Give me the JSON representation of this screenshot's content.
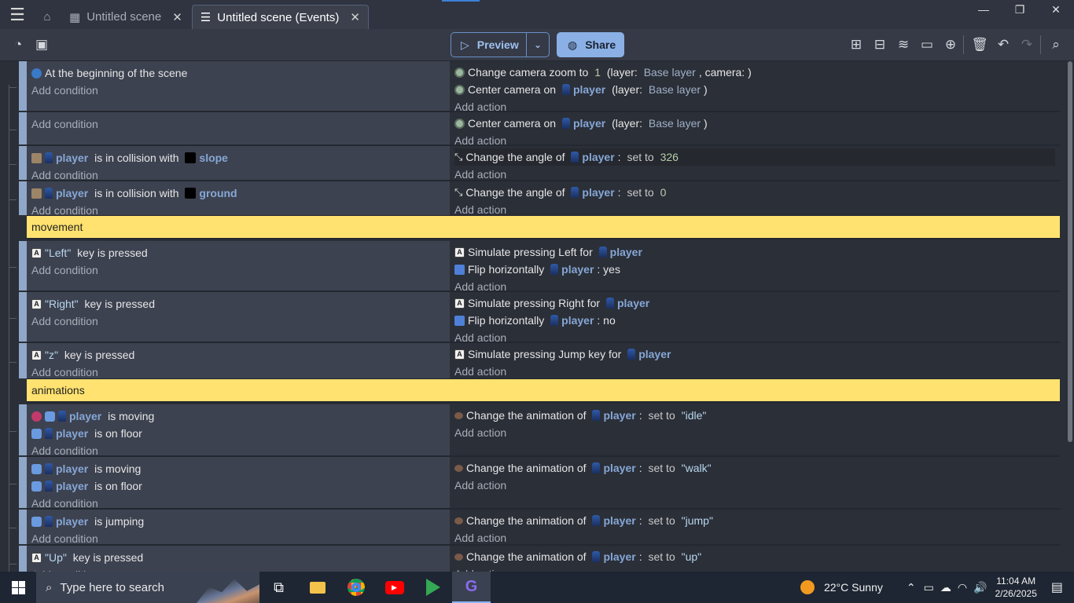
{
  "titlebar": {
    "tabs": [
      {
        "label": "Untitled scene"
      },
      {
        "label": "Untitled scene (Events)"
      }
    ]
  },
  "toolbar": {
    "preview_label": "Preview",
    "share_label": "Share"
  },
  "events": [
    {
      "conditions": [
        [
          {
            "icon": "scene-icon"
          },
          {
            "t": "At the beginning of the scene"
          }
        ]
      ],
      "actions": [
        [
          {
            "icon": "camera-icon"
          },
          {
            "t": "Change camera zoom to "
          },
          {
            "t": "1",
            "c": "num"
          },
          {
            "t": " (layer: "
          },
          {
            "t": "Base layer",
            "c": "prm"
          },
          {
            "t": ", camera: )"
          }
        ],
        [
          {
            "icon": "camera-icon"
          },
          {
            "t": "Center camera on "
          },
          {
            "icon": "player-icon"
          },
          {
            "t": "player",
            "c": "obj"
          },
          {
            "t": " (layer: "
          },
          {
            "t": "Base layer",
            "c": "prm"
          },
          {
            "t": ")"
          }
        ]
      ]
    },
    {
      "conditions": [],
      "actions": [
        [
          {
            "icon": "camera-icon"
          },
          {
            "t": "Center camera on "
          },
          {
            "icon": "player-icon"
          },
          {
            "t": "player",
            "c": "obj"
          },
          {
            "t": " (layer: "
          },
          {
            "t": "Base layer",
            "c": "prm"
          },
          {
            "t": ")"
          }
        ]
      ]
    },
    {
      "conditions": [
        [
          {
            "icon": "collision-icon"
          },
          {
            "icon": "player-icon"
          },
          {
            "t": "player",
            "c": "obj"
          },
          {
            "t": " is in collision with "
          },
          {
            "icon": "black-square-icon"
          },
          {
            "t": "slope",
            "c": "obj"
          }
        ]
      ],
      "actions": [
        [
          {
            "icon": "angle-icon"
          },
          {
            "t": "Change the angle of "
          },
          {
            "icon": "player-icon"
          },
          {
            "t": "player",
            "c": "obj"
          },
          {
            "t": ": "
          },
          {
            "t": "set to ",
            "c": "mid"
          },
          {
            "t": "326",
            "c": "num"
          }
        ]
      ],
      "hl": true
    },
    {
      "conditions": [
        [
          {
            "icon": "collision-icon"
          },
          {
            "icon": "player-icon"
          },
          {
            "t": "player",
            "c": "obj"
          },
          {
            "t": " is in collision with "
          },
          {
            "icon": "black-square-icon"
          },
          {
            "t": "ground",
            "c": "obj"
          }
        ]
      ],
      "actions": [
        [
          {
            "icon": "angle-icon"
          },
          {
            "t": "Change the angle of "
          },
          {
            "icon": "player-icon"
          },
          {
            "t": "player",
            "c": "obj"
          },
          {
            "t": ": "
          },
          {
            "t": "set to ",
            "c": "mid"
          },
          {
            "t": "0",
            "c": "num"
          }
        ]
      ]
    },
    {
      "group": "movement"
    },
    {
      "conditions": [
        [
          {
            "icon": "key-icon"
          },
          {
            "t": "\"Left\"",
            "c": "str"
          },
          {
            "t": " key is pressed"
          }
        ]
      ],
      "actions": [
        [
          {
            "icon": "key-icon"
          },
          {
            "t": "Simulate pressing Left for "
          },
          {
            "icon": "player-icon"
          },
          {
            "t": "player",
            "c": "obj"
          }
        ],
        [
          {
            "icon": "flip-icon"
          },
          {
            "t": "Flip horizontally "
          },
          {
            "icon": "player-icon"
          },
          {
            "t": "player",
            "c": "obj"
          },
          {
            "t": ": yes"
          }
        ]
      ]
    },
    {
      "conditions": [
        [
          {
            "icon": "key-icon"
          },
          {
            "t": "\"Right\"",
            "c": "str"
          },
          {
            "t": " key is pressed"
          }
        ]
      ],
      "actions": [
        [
          {
            "icon": "key-icon"
          },
          {
            "t": "Simulate pressing Right for "
          },
          {
            "icon": "player-icon"
          },
          {
            "t": "player",
            "c": "obj"
          }
        ],
        [
          {
            "icon": "flip-icon"
          },
          {
            "t": "Flip horizontally "
          },
          {
            "icon": "player-icon"
          },
          {
            "t": "player",
            "c": "obj"
          },
          {
            "t": ": no"
          }
        ]
      ]
    },
    {
      "conditions": [
        [
          {
            "icon": "key-icon"
          },
          {
            "t": "\"z\"",
            "c": "str"
          },
          {
            "t": " key is pressed"
          }
        ]
      ],
      "actions": [
        [
          {
            "icon": "key-icon"
          },
          {
            "t": "Simulate pressing Jump key for "
          },
          {
            "icon": "player-icon"
          },
          {
            "t": "player",
            "c": "obj"
          }
        ]
      ]
    },
    {
      "group": "animations"
    },
    {
      "conditions": [
        [
          {
            "icon": "invert-icon"
          },
          {
            "icon": "platformer-icon"
          },
          {
            "icon": "player-icon"
          },
          {
            "t": "player",
            "c": "obj"
          },
          {
            "t": " is moving"
          }
        ],
        [
          {
            "icon": "platformer-icon"
          },
          {
            "icon": "player-icon"
          },
          {
            "t": "player",
            "c": "obj"
          },
          {
            "t": " is on floor"
          }
        ]
      ],
      "actions": [
        [
          {
            "icon": "animation-icon"
          },
          {
            "t": "Change the animation of "
          },
          {
            "icon": "player-icon"
          },
          {
            "t": "player",
            "c": "obj"
          },
          {
            "t": ": "
          },
          {
            "t": "set to ",
            "c": "mid"
          },
          {
            "t": "\"idle\"",
            "c": "str"
          }
        ]
      ]
    },
    {
      "conditions": [
        [
          {
            "icon": "platformer-icon"
          },
          {
            "icon": "player-icon"
          },
          {
            "t": "player",
            "c": "obj"
          },
          {
            "t": " is moving"
          }
        ],
        [
          {
            "icon": "platformer-icon"
          },
          {
            "icon": "player-icon"
          },
          {
            "t": "player",
            "c": "obj"
          },
          {
            "t": " is on floor"
          }
        ]
      ],
      "actions": [
        [
          {
            "icon": "animation-icon"
          },
          {
            "t": "Change the animation of "
          },
          {
            "icon": "player-icon"
          },
          {
            "t": "player",
            "c": "obj"
          },
          {
            "t": ": "
          },
          {
            "t": "set to ",
            "c": "mid"
          },
          {
            "t": "\"walk\"",
            "c": "str"
          }
        ]
      ]
    },
    {
      "conditions": [
        [
          {
            "icon": "platformer-icon"
          },
          {
            "icon": "player-icon"
          },
          {
            "t": "player",
            "c": "obj"
          },
          {
            "t": " is jumping"
          }
        ]
      ],
      "actions": [
        [
          {
            "icon": "animation-icon"
          },
          {
            "t": "Change the animation of "
          },
          {
            "icon": "player-icon"
          },
          {
            "t": "player",
            "c": "obj"
          },
          {
            "t": ": "
          },
          {
            "t": "set to ",
            "c": "mid"
          },
          {
            "t": "\"jump\"",
            "c": "str"
          }
        ]
      ]
    },
    {
      "conditions": [
        [
          {
            "icon": "key-icon"
          },
          {
            "t": "\"Up\"",
            "c": "str"
          },
          {
            "t": " key is pressed"
          }
        ]
      ],
      "actions": [
        [
          {
            "icon": "animation-icon"
          },
          {
            "t": "Change the animation of "
          },
          {
            "icon": "player-icon"
          },
          {
            "t": "player",
            "c": "obj"
          },
          {
            "t": ": "
          },
          {
            "t": "set to ",
            "c": "mid"
          },
          {
            "t": "\"up\"",
            "c": "str"
          }
        ]
      ]
    }
  ],
  "labels": {
    "add_condition": "Add condition",
    "add_action": "Add action"
  },
  "taskbar": {
    "search_placeholder": "Type here to search",
    "weather": "22°C  Sunny",
    "time": "11:04 AM",
    "date": "2/26/2025"
  }
}
